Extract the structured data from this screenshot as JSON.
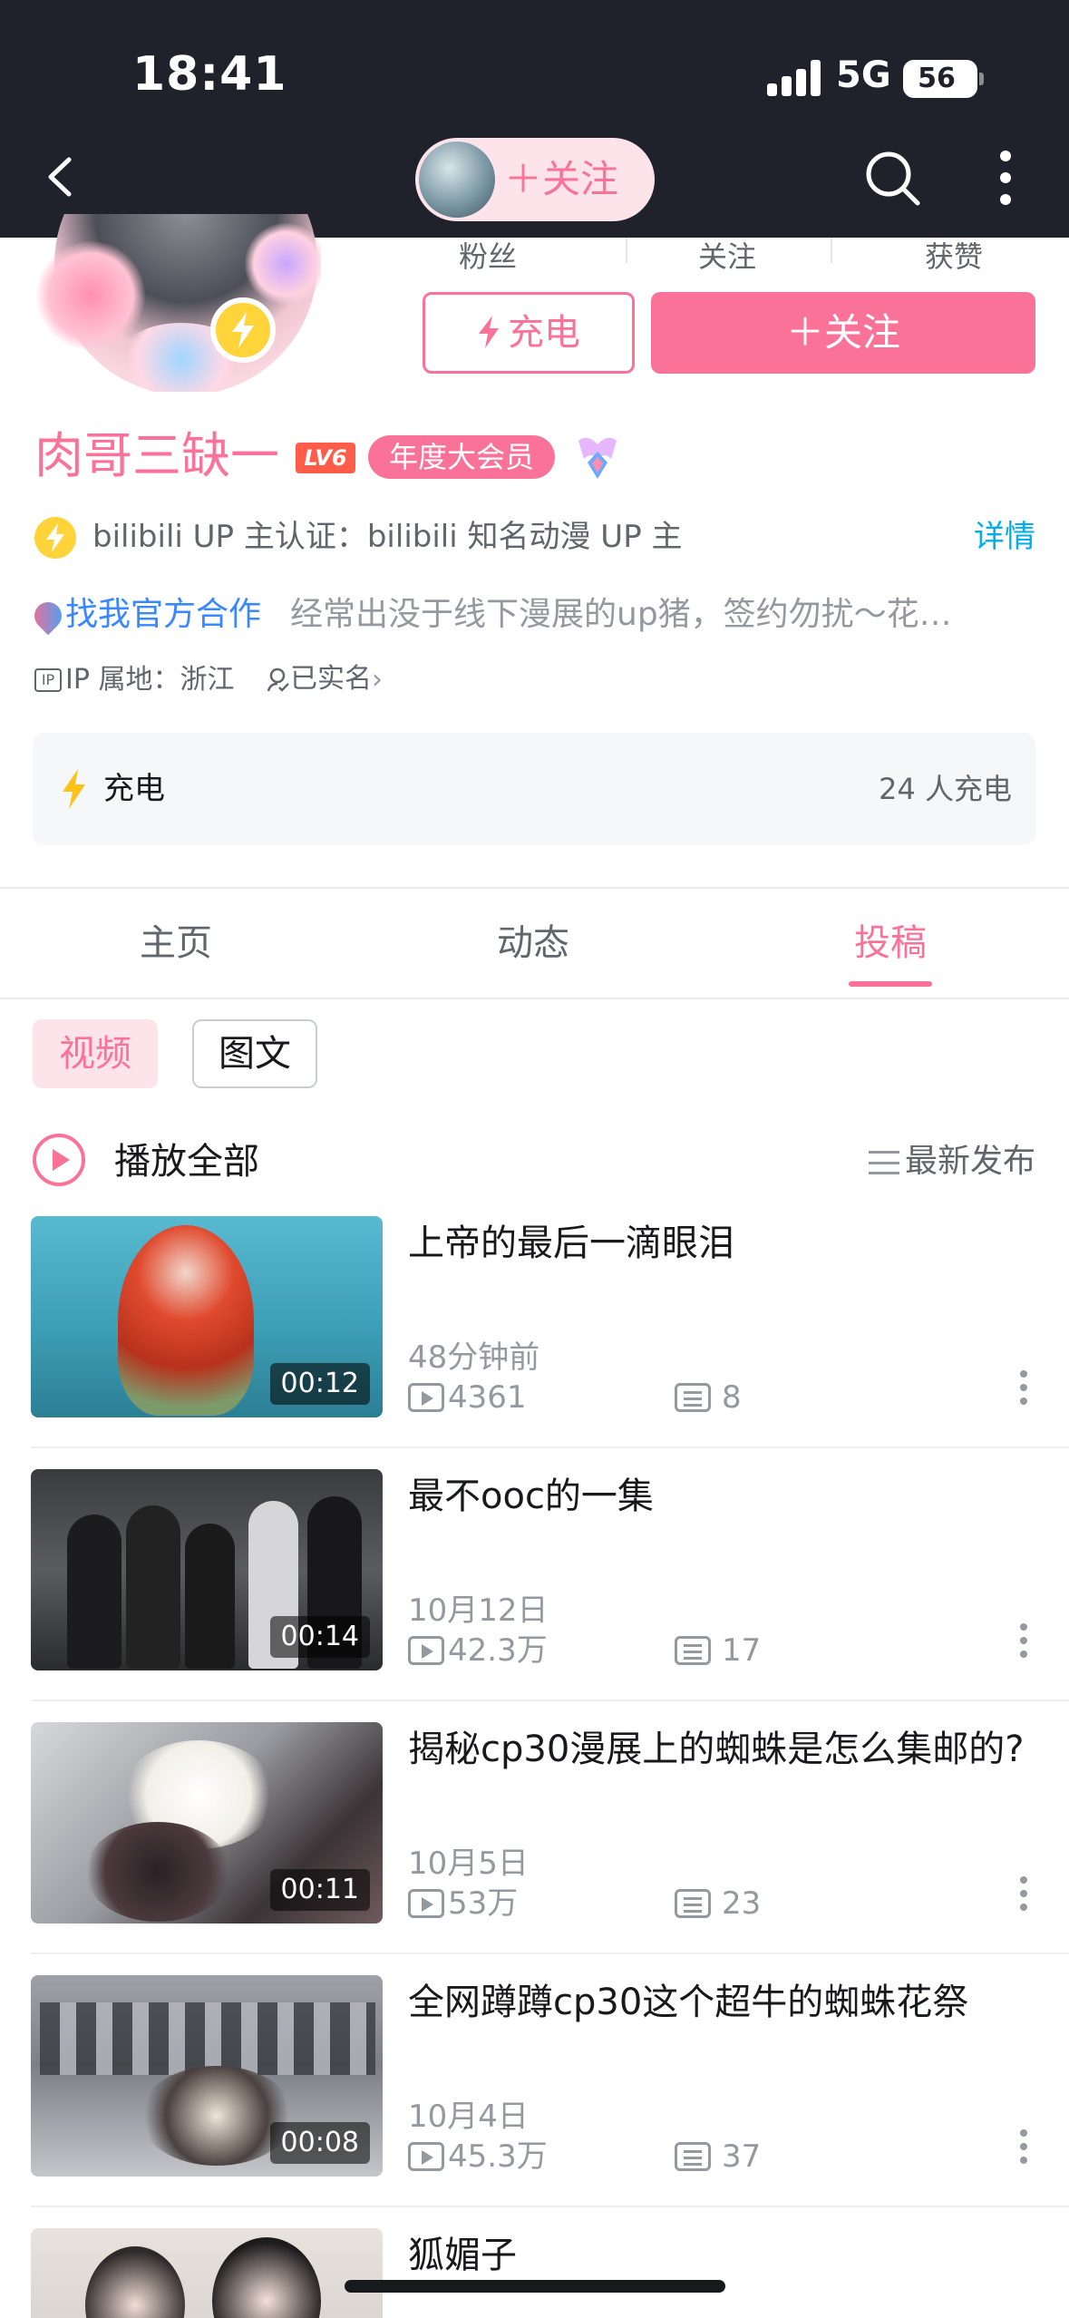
{
  "status_bar": {
    "time": "18:41",
    "network": "5G",
    "battery": "56"
  },
  "top_nav": {
    "follow_pill_label": "＋关注"
  },
  "stats": {
    "fans_label": "粉丝",
    "following_label": "关注",
    "likes_label": "获赞"
  },
  "actions": {
    "charge_label": "充电",
    "follow_label": "＋关注"
  },
  "profile": {
    "name": "肉哥三缺一",
    "level": "LV6",
    "vip": "年度大会员",
    "verification": "bilibili UP 主认证：bilibili 知名动漫 UP 主",
    "detail_link": "详情",
    "bio_link": "找我官方合作",
    "bio": "经常出没于线下漫展的up猪，签约勿扰～花…",
    "ip_icon": "IP",
    "ip_location": "IP 属地：浙江",
    "real_name": "已实名"
  },
  "charge_card": {
    "label": "充电",
    "count": "24 人充电"
  },
  "tabs": [
    {
      "label": "主页",
      "active": false
    },
    {
      "label": "动态",
      "active": false
    },
    {
      "label": "投稿",
      "active": true
    }
  ],
  "sub_tabs": [
    {
      "label": "视频",
      "active": true
    },
    {
      "label": "图文",
      "active": false
    }
  ],
  "list_header": {
    "play_all": "播放全部",
    "sort": "最新发布"
  },
  "videos": [
    {
      "title": "上帝的最后一滴眼泪",
      "duration": "00:12",
      "date": "48分钟前",
      "views": "4361",
      "comments": "8"
    },
    {
      "title": "最不ooc的一集",
      "duration": "00:14",
      "date": "10月12日",
      "views": "42.3万",
      "comments": "17"
    },
    {
      "title": "揭秘cp30漫展上的蜘蛛是怎么集邮的?",
      "duration": "00:11",
      "date": "10月5日",
      "views": "53万",
      "comments": "23"
    },
    {
      "title": "全网蹲蹲cp30这个超牛的蜘蛛花祭",
      "duration": "00:08",
      "date": "10月4日",
      "views": "45.3万",
      "comments": "37"
    },
    {
      "title": "狐媚子"
    }
  ],
  "colors": {
    "accent": "#fb7299",
    "link": "#00aeec",
    "header_bg": "#1f222b",
    "charge_yellow": "#ffd43b"
  }
}
